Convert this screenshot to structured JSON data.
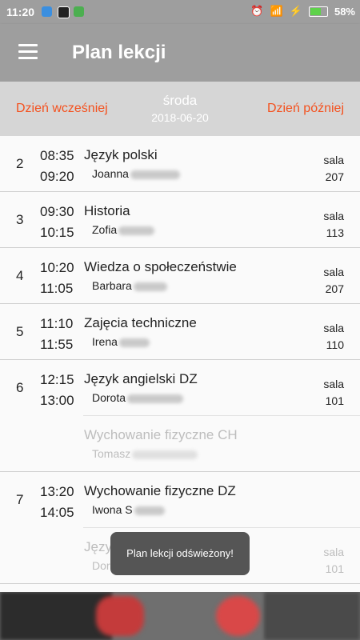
{
  "status": {
    "time": "11:20",
    "battery": "58%",
    "battery_level": 0.58
  },
  "app": {
    "title": "Plan lekcji"
  },
  "day": {
    "prev_label": "Dzień wcześniej",
    "next_label": "Dzień później",
    "weekday": "środa",
    "date": "2018-06-20"
  },
  "lessons": [
    {
      "num": "2",
      "start": "08:35",
      "end": "09:20",
      "items": [
        {
          "subject": "Język polski",
          "teacher": "Joanna",
          "room_label": "sala",
          "room": "207"
        }
      ]
    },
    {
      "num": "3",
      "start": "09:30",
      "end": "10:15",
      "items": [
        {
          "subject": "Historia",
          "teacher": "Zofia",
          "room_label": "sala",
          "room": "113"
        }
      ]
    },
    {
      "num": "4",
      "start": "10:20",
      "end": "11:05",
      "items": [
        {
          "subject": "Wiedza o społeczeństwie",
          "teacher": "Barbara",
          "room_label": "sala",
          "room": "207"
        }
      ]
    },
    {
      "num": "5",
      "start": "11:10",
      "end": "11:55",
      "items": [
        {
          "subject": "Zajęcia techniczne",
          "teacher": "Irena",
          "room_label": "sala",
          "room": "110"
        }
      ]
    },
    {
      "num": "6",
      "start": "12:15",
      "end": "13:00",
      "items": [
        {
          "subject": "Język angielski  DZ",
          "teacher": "Dorota",
          "room_label": "sala",
          "room": "101"
        },
        {
          "subject": "Wychowanie fizyczne  CH",
          "teacher": "Tomasz",
          "room_label": "",
          "room": ""
        }
      ]
    },
    {
      "num": "7",
      "start": "13:20",
      "end": "14:05",
      "items": [
        {
          "subject": "Wychowanie fizyczne  DZ",
          "teacher": "Iwona S",
          "room_label": "",
          "room": ""
        },
        {
          "subject": "Język",
          "teacher": "Dorota",
          "room_label": "sala",
          "room": "101"
        }
      ]
    }
  ],
  "toast": {
    "message": "Plan lekcji odświeżony!"
  }
}
